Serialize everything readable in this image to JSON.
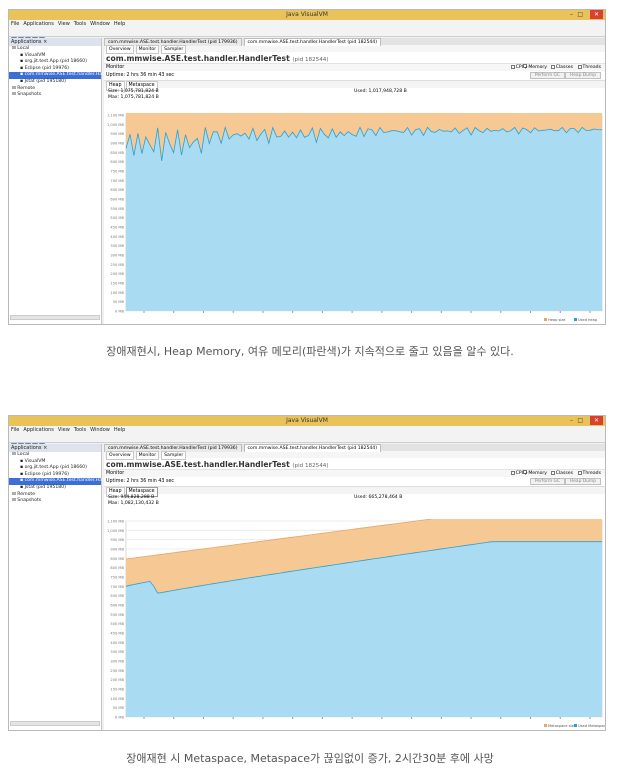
{
  "window_title": "Java VisualVM",
  "menu": [
    "File",
    "Applications",
    "View",
    "Tools",
    "Window",
    "Help"
  ],
  "apps_panel": {
    "header": "Applications ×",
    "items": [
      {
        "label": "Local",
        "indent": 0
      },
      {
        "label": "VisualVM",
        "indent": 1
      },
      {
        "label": "org.jit.test.App (pid 18660)",
        "indent": 1
      },
      {
        "label": "Eclipse (pid 19976)",
        "indent": 1
      },
      {
        "label": "com.mmwise.ASE.test.handler.HandlerTest (pid 182544)",
        "indent": 1,
        "selected": true
      },
      {
        "label": "Jstat (pid 195180)",
        "indent": 1
      },
      {
        "label": "Remote",
        "indent": 0
      },
      {
        "label": "Snapshots",
        "indent": 0
      }
    ]
  },
  "doc_tabs": [
    "com.mmwise.ASE.test.handler.HandlerTest (pid 179936)",
    "com.mmwise.ASE.test.handler.HandlerTest (pid 182544)"
  ],
  "view_tabs": [
    "Overview",
    "Monitor",
    "Sampler"
  ],
  "app_title": "com.mmwise.ASE.test.handler.HandlerTest",
  "app_pid": "(pid 182544)",
  "monitor_label": "Monitor",
  "checkboxes": [
    {
      "label": "CPU",
      "checked": false
    },
    {
      "label": "Memory",
      "checked": true
    },
    {
      "label": "Classes",
      "checked": false
    },
    {
      "label": "Threads",
      "checked": false
    }
  ],
  "buttons": {
    "gc": "Perform GC",
    "dump": "Heap Dump"
  },
  "sub_tabs": [
    "Heap",
    "Metaspace"
  ],
  "y_ticks": [
    "1,100 MB",
    "1,000 MB",
    "950 MB",
    "900 MB",
    "850 MB",
    "800 MB",
    "750 MB",
    "700 MB",
    "650 MB",
    "600 MB",
    "550 MB",
    "500 MB",
    "450 MB",
    "400 MB",
    "350 MB",
    "300 MB",
    "250 MB",
    "200 MB",
    "150 MB",
    "100 MB",
    "50 MB",
    "0 MB"
  ],
  "panels": [
    {
      "uptime": "Uptime: 2 hrs 36 min 43 sec",
      "size_label": "Size: 1,075,781,824 B",
      "max_label": "Max: 1,075,781,824 B",
      "used_label": "Used: 1,017,948,728 B",
      "legend": [
        "Heap size",
        "Used heap"
      ],
      "caption": "장애재현시, Heap Memory, 여유 메모리(파란색)가 지속적으로 줄고 있음을 알수 있다."
    },
    {
      "uptime": "Uptime: 2 hrs 36 min 43 sec",
      "size_label": "Size: 944,828,288 B",
      "max_label": "Max: 1,082,130,432 B",
      "used_label": "Used: 665,278,464 B",
      "legend": [
        "Metaspace size",
        "Used Metaspace"
      ],
      "caption": "장애재현 시 Metaspace, Metaspace가 끊임없이 증가, 2시간30분 후에 사망"
    }
  ],
  "colors": {
    "size_fill": "#f6c894",
    "used_fill": "#a9dcf2",
    "used_line": "#2aa0cf",
    "size_line": "#e3a76a",
    "selected": "#3b6fd6"
  }
}
